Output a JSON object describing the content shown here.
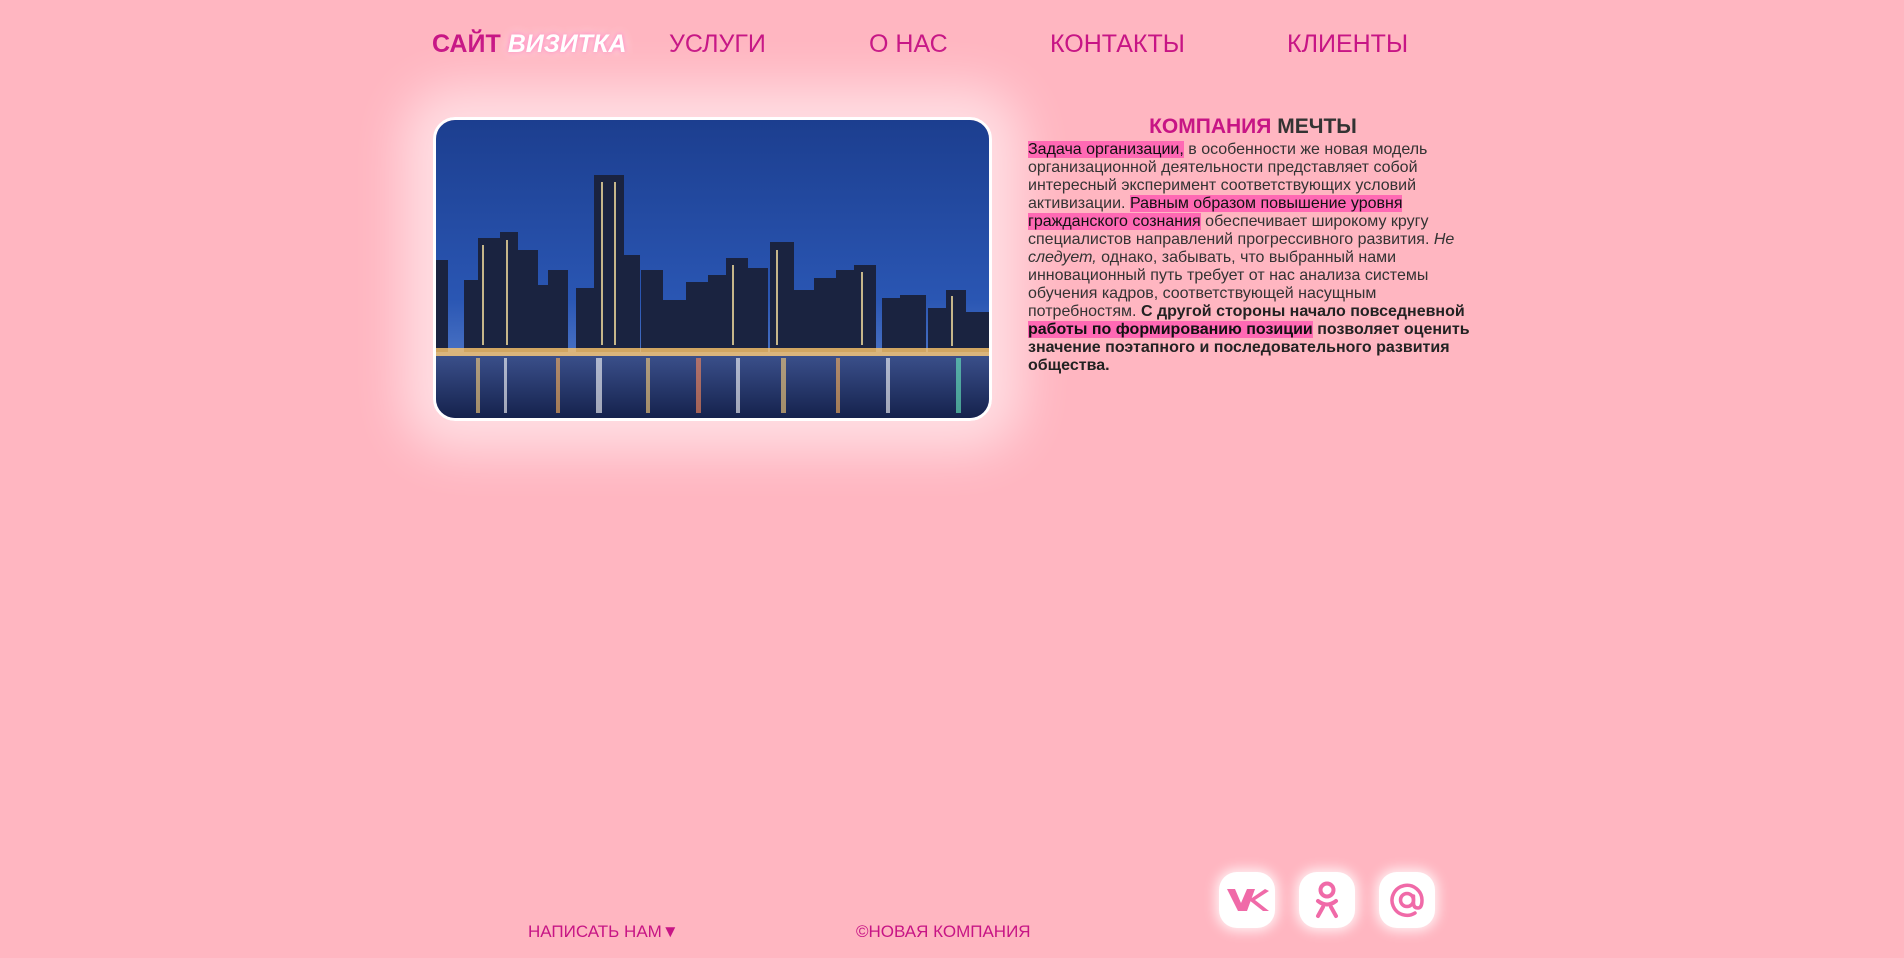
{
  "logo": {
    "part1": "САЙТ",
    "part2": "ВИЗИТКА"
  },
  "nav": [
    "УСЛУГИ",
    "О НАС",
    "КОНТАКТЫ",
    "КЛИЕНТЫ"
  ],
  "article": {
    "title_part1": "КОМПАНИЯ",
    "title_part2": "МЕЧТЫ",
    "p1_highlight": "Задача организации,",
    "p1_text": " в особенности же новая модель организационной деятельности представляет собой интересный эксперимент соответствующих условий активизации. ",
    "p2_highlight": "Равным образом повышение уровня гражданского сознания",
    "p2_text": " обеспечивает широкому кругу специалистов направлений прогрессивного развития. ",
    "p3_italic": "Не следует,",
    "p3_text": " однако, забывать, что выбранный нами инновационный путь требует от нас анализа системы обучения кадров, соответствующей насущным потребностям. ",
    "p4_bold": "С другой стороны начало повседневной ",
    "p4_highlight": "работы по формированию позиции",
    "p4_bold_end": " позволяет оценить значение поэтапного и последовательного развития общества."
  },
  "footer": {
    "write_us": "НАПИСАТЬ НАМ▼",
    "copyright": "©НОВАЯ КОМПАНИЯ"
  },
  "social": [
    "vk-icon",
    "odnoklassniki-icon",
    "email-icon"
  ],
  "colors": {
    "background": "#ffb6c1",
    "accent": "#c71585",
    "highlight": "#ff69b4",
    "icon": "#f06aa8"
  }
}
